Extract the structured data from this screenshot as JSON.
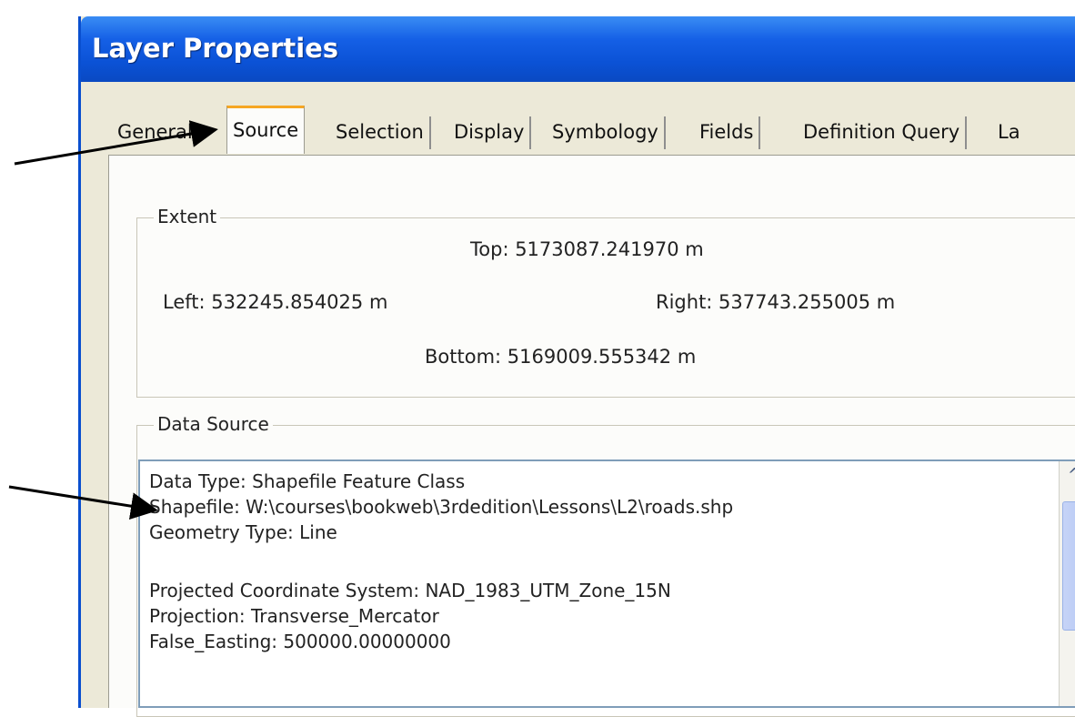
{
  "window": {
    "title": "Layer Properties"
  },
  "tabs": [
    "General",
    "Source",
    "Selection",
    "Display",
    "Symbology",
    "Fields",
    "Definition Query",
    "La"
  ],
  "active_tab": "Source",
  "extent": {
    "label": "Extent",
    "top": "Top:  5173087.241970 m",
    "left": "Left:  532245.854025 m",
    "right": "Right:  537743.255005 m",
    "bottom": "Bottom:  5169009.555342 m"
  },
  "data_source": {
    "label": "Data Source",
    "lines": [
      "Data Type: Shapefile Feature Class",
      "Shapefile: W:\\courses\\bookweb\\3rdedition\\Lessons\\L2\\roads.shp",
      "Geometry Type: Line",
      "",
      "Projected Coordinate System: NAD_1983_UTM_Zone_15N",
      "Projection: Transverse_Mercator",
      "False_Easting: 500000.00000000"
    ]
  },
  "scrollbar": {
    "up_glyph": "^"
  },
  "colors": {
    "titlebar": "#0b52d6",
    "active_tab_accent": "#f5a623",
    "dialog_bg": "#ece9d8"
  }
}
